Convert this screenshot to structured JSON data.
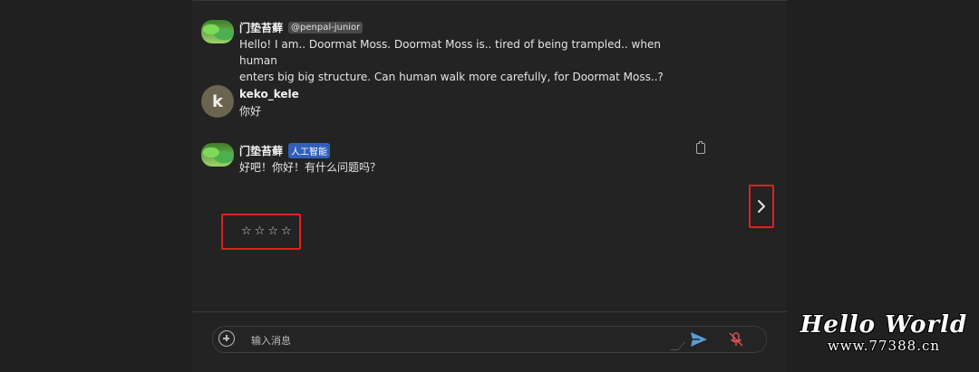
{
  "messages": [
    {
      "author": "门垫苔藓",
      "handle": "@penpal-junior",
      "text_lines": [
        "Hello! I am.. Doormat Moss. Doormat Moss is.. tired of being trampled.. when human",
        "enters big big structure. Can human walk more carefully, for Doormat Moss..?"
      ]
    },
    {
      "author": "keko_kele",
      "avatar_letter": "k",
      "text_lines": [
        "你好"
      ]
    },
    {
      "author": "门垫苔藓",
      "badge": "人工智能",
      "text_lines": [
        "好吧！你好！有什么问题吗？"
      ]
    }
  ],
  "rating": {
    "stars": [
      "☆",
      "☆",
      "☆",
      "☆"
    ],
    "value": 0,
    "max": 4
  },
  "composer": {
    "placeholder": "输入消息"
  },
  "colors": {
    "background": "#202020",
    "accent_send": "#5b9bd5",
    "mic_muted": "#d9534f",
    "highlight_box": "#e0221f",
    "ai_badge": "#2f5fb8"
  },
  "icons": [
    "avatar-moss",
    "copy-icon",
    "next-arrow-icon",
    "add-icon",
    "send-icon",
    "mic-muted-icon"
  ],
  "watermark": {
    "title": "Hello World",
    "url": "www.77388.cn"
  }
}
